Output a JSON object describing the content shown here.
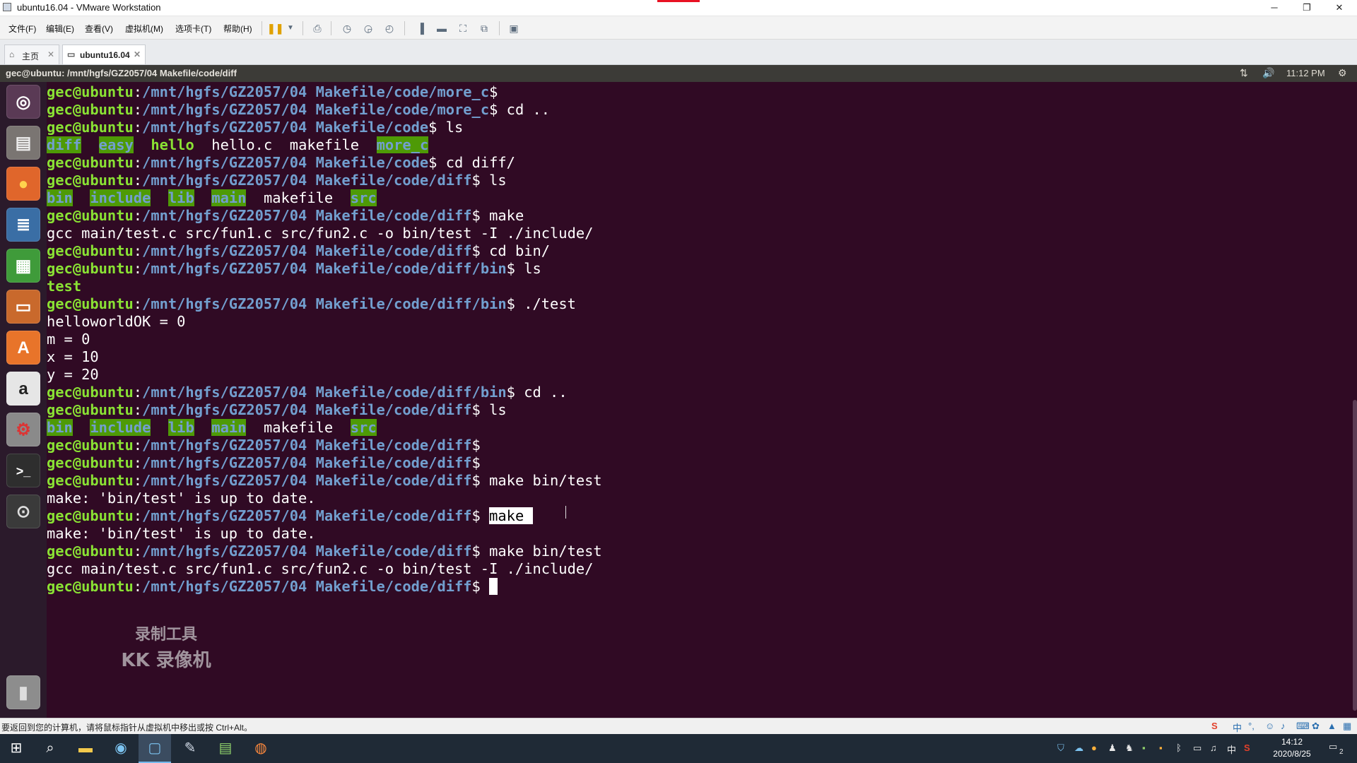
{
  "window": {
    "title": "ubuntu16.04 - VMware Workstation",
    "controls": {
      "minimize": "─",
      "restore": "❐",
      "close": "✕"
    }
  },
  "menubar": {
    "items": [
      "文件(F)",
      "编辑(E)",
      "查看(V)",
      "虚拟机(M)",
      "选项卡(T)",
      "帮助(H)"
    ]
  },
  "tabs": [
    {
      "label": "主页",
      "icon": "home-icon"
    },
    {
      "label": "ubuntu16.04",
      "icon": "vm-icon"
    }
  ],
  "ubuntu_panel": {
    "window_title": "gec@ubuntu: /mnt/hgfs/GZ2057/04 Makefile/code/diff",
    "time": "11:12 PM"
  },
  "terminal": {
    "prompt_user": "gec@ubuntu",
    "lines": [
      {
        "type": "prompt",
        "path": "/mnt/hgfs/GZ2057/04 Makefile/code/more_c",
        "cmd": ""
      },
      {
        "type": "prompt",
        "path": "/mnt/hgfs/GZ2057/04 Makefile/code/more_c",
        "cmd": "cd .."
      },
      {
        "type": "prompt",
        "path": "/mnt/hgfs/GZ2057/04 Makefile/code",
        "cmd": "ls"
      },
      {
        "type": "ls",
        "entries": [
          {
            "name": "diff",
            "kind": "dir"
          },
          {
            "name": "easy",
            "kind": "dir"
          },
          {
            "name": "hello",
            "kind": "exec"
          },
          {
            "name": "hello.c",
            "kind": "file"
          },
          {
            "name": "makefile",
            "kind": "file"
          },
          {
            "name": "more_c",
            "kind": "dir"
          }
        ]
      },
      {
        "type": "prompt",
        "path": "/mnt/hgfs/GZ2057/04 Makefile/code",
        "cmd": "cd diff/"
      },
      {
        "type": "prompt",
        "path": "/mnt/hgfs/GZ2057/04 Makefile/code/diff",
        "cmd": "ls"
      },
      {
        "type": "ls",
        "entries": [
          {
            "name": "bin",
            "kind": "dir"
          },
          {
            "name": "include",
            "kind": "dir"
          },
          {
            "name": "lib",
            "kind": "dir"
          },
          {
            "name": "main",
            "kind": "dir"
          },
          {
            "name": "makefile",
            "kind": "file"
          },
          {
            "name": "src",
            "kind": "dir"
          }
        ]
      },
      {
        "type": "prompt",
        "path": "/mnt/hgfs/GZ2057/04 Makefile/code/diff",
        "cmd": "make"
      },
      {
        "type": "output",
        "text": "gcc main/test.c src/fun1.c src/fun2.c -o bin/test -I ./include/"
      },
      {
        "type": "prompt",
        "path": "/mnt/hgfs/GZ2057/04 Makefile/code/diff",
        "cmd": "cd bin/"
      },
      {
        "type": "prompt",
        "path": "/mnt/hgfs/GZ2057/04 Makefile/code/diff/bin",
        "cmd": "ls"
      },
      {
        "type": "ls",
        "entries": [
          {
            "name": "test",
            "kind": "exec"
          }
        ]
      },
      {
        "type": "prompt",
        "path": "/mnt/hgfs/GZ2057/04 Makefile/code/diff/bin",
        "cmd": "./test"
      },
      {
        "type": "output",
        "text": "helloworldOK = 0"
      },
      {
        "type": "output",
        "text": "m = 0"
      },
      {
        "type": "output",
        "text": "x = 10"
      },
      {
        "type": "output",
        "text": "y = 20"
      },
      {
        "type": "prompt",
        "path": "/mnt/hgfs/GZ2057/04 Makefile/code/diff/bin",
        "cmd": "cd .."
      },
      {
        "type": "prompt",
        "path": "/mnt/hgfs/GZ2057/04 Makefile/code/diff",
        "cmd": "ls"
      },
      {
        "type": "ls",
        "entries": [
          {
            "name": "bin",
            "kind": "dir"
          },
          {
            "name": "include",
            "kind": "dir"
          },
          {
            "name": "lib",
            "kind": "dir"
          },
          {
            "name": "main",
            "kind": "dir"
          },
          {
            "name": "makefile",
            "kind": "file"
          },
          {
            "name": "src",
            "kind": "dir"
          }
        ]
      },
      {
        "type": "prompt",
        "path": "/mnt/hgfs/GZ2057/04 Makefile/code/diff",
        "cmd": ""
      },
      {
        "type": "prompt",
        "path": "/mnt/hgfs/GZ2057/04 Makefile/code/diff",
        "cmd": ""
      },
      {
        "type": "prompt",
        "path": "/mnt/hgfs/GZ2057/04 Makefile/code/diff",
        "cmd": "make bin/test"
      },
      {
        "type": "output",
        "text": "make: 'bin/test' is up to date."
      },
      {
        "type": "prompt",
        "path": "/mnt/hgfs/GZ2057/04 Makefile/code/diff",
        "cmd": "make ",
        "selected": true
      },
      {
        "type": "output",
        "text": "make: 'bin/test' is up to date."
      },
      {
        "type": "prompt",
        "path": "/mnt/hgfs/GZ2057/04 Makefile/code/diff",
        "cmd": "make bin/test"
      },
      {
        "type": "output",
        "text": "gcc main/test.c src/fun1.c src/fun2.c -o bin/test -I ./include/"
      },
      {
        "type": "prompt",
        "path": "/mnt/hgfs/GZ2057/04 Makefile/code/diff",
        "cmd": "",
        "cursor": true
      }
    ]
  },
  "watermark": {
    "line1": "录制工具",
    "line2": "KK 录像机"
  },
  "statusbar": {
    "text": "要返回到您的计算机，请将鼠标指针从虚拟机中移出或按 Ctrl+Alt。",
    "ime_label": "中"
  },
  "taskbar": {
    "clock_time": "14:12",
    "clock_date": "2020/8/25",
    "tray_ime": "中",
    "notification_count": "2"
  },
  "colors": {
    "terminal_bg": "#300a24",
    "prompt_user": "#8ae234",
    "prompt_path": "#729fcf",
    "dir_bg": "#4e9a06",
    "launcher_bg": "#2b1a2b",
    "panel_bg": "#3c3b37"
  }
}
